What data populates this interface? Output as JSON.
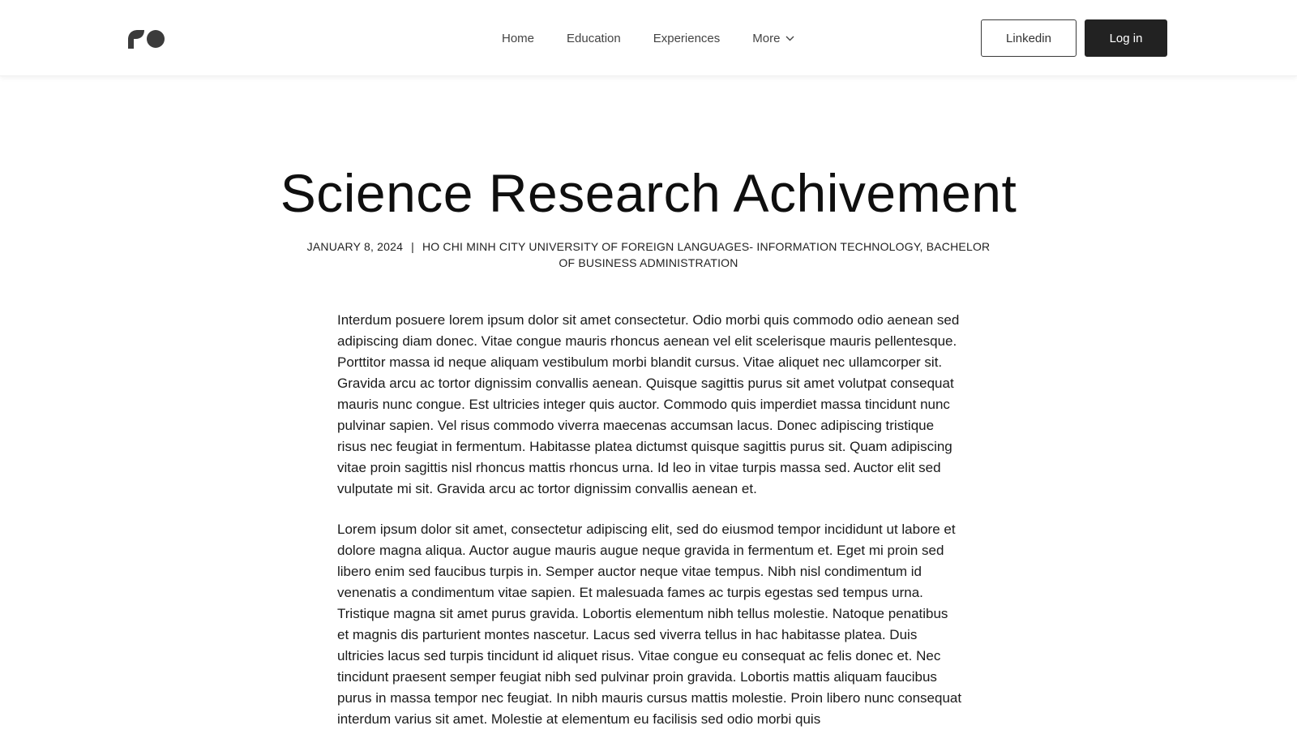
{
  "header": {
    "logo_icon": "brand-logo-icon",
    "nav": [
      {
        "label": "Home"
      },
      {
        "label": "Education"
      },
      {
        "label": "Experiences"
      },
      {
        "label": "More",
        "icon": "chevron-down-icon"
      }
    ],
    "linkedin_label": "Linkedin",
    "login_label": "Log in"
  },
  "post": {
    "title": "Science Research Achivement",
    "date": "JANUARY 8, 2024",
    "separator": "|",
    "category": "HO CHI MINH CITY UNIVERSITY OF FOREIGN LANGUAGES- INFORMATION TECHNOLOGY, BACHELOR OF BUSINESS ADMINISTRATION",
    "paragraphs": [
      "Interdum posuere lorem ipsum dolor sit amet consectetur. Odio morbi quis commodo odio aenean sed adipiscing diam donec. Vitae congue mauris rhoncus aenean vel elit scelerisque mauris pellentesque. Porttitor massa id neque aliquam vestibulum morbi blandit cursus. Vitae aliquet nec ullamcorper sit. Gravida arcu ac tortor dignissim convallis aenean. Quisque sagittis purus sit amet volutpat consequat mauris nunc congue. Est ultricies integer quis auctor. Commodo quis imperdiet massa tincidunt nunc pulvinar sapien. Vel risus commodo viverra maecenas accumsan lacus. Donec adipiscing tristique risus nec feugiat in fermentum. Habitasse platea dictumst quisque sagittis purus sit. Quam adipiscing vitae proin sagittis nisl rhoncus mattis rhoncus urna. Id leo in vitae turpis massa sed. Auctor elit sed vulputate mi sit. Gravida arcu ac tortor dignissim convallis aenean et.",
      "Lorem ipsum dolor sit amet, consectetur adipiscing elit, sed do eiusmod tempor incididunt ut labore et dolore magna aliqua. Auctor augue mauris augue neque gravida in fermentum et. Eget mi proin sed libero enim sed faucibus turpis in. Semper auctor neque vitae tempus. Nibh nisl condimentum id venenatis a condimentum vitae sapien. Et malesuada fames ac turpis egestas sed tempus urna. Tristique magna sit amet purus gravida. Lobortis elementum nibh tellus molestie. Natoque penatibus et magnis dis parturient montes nascetur. Lacus sed viverra tellus in hac habitasse platea. Duis ultricies lacus sed turpis tincidunt id aliquet risus. Vitae congue eu consequat ac felis donec et. Nec tincidunt praesent semper feugiat nibh sed pulvinar proin gravida. Lobortis mattis aliquam faucibus purus in massa tempor nec feugiat. In nibh mauris cursus mattis molestie. Proin libero nunc consequat interdum varius sit amet. Molestie at elementum eu facilisis sed odio morbi quis"
    ]
  },
  "colors": {
    "primary_button": "#222222",
    "text": "#111111",
    "background": "#ffffff"
  }
}
